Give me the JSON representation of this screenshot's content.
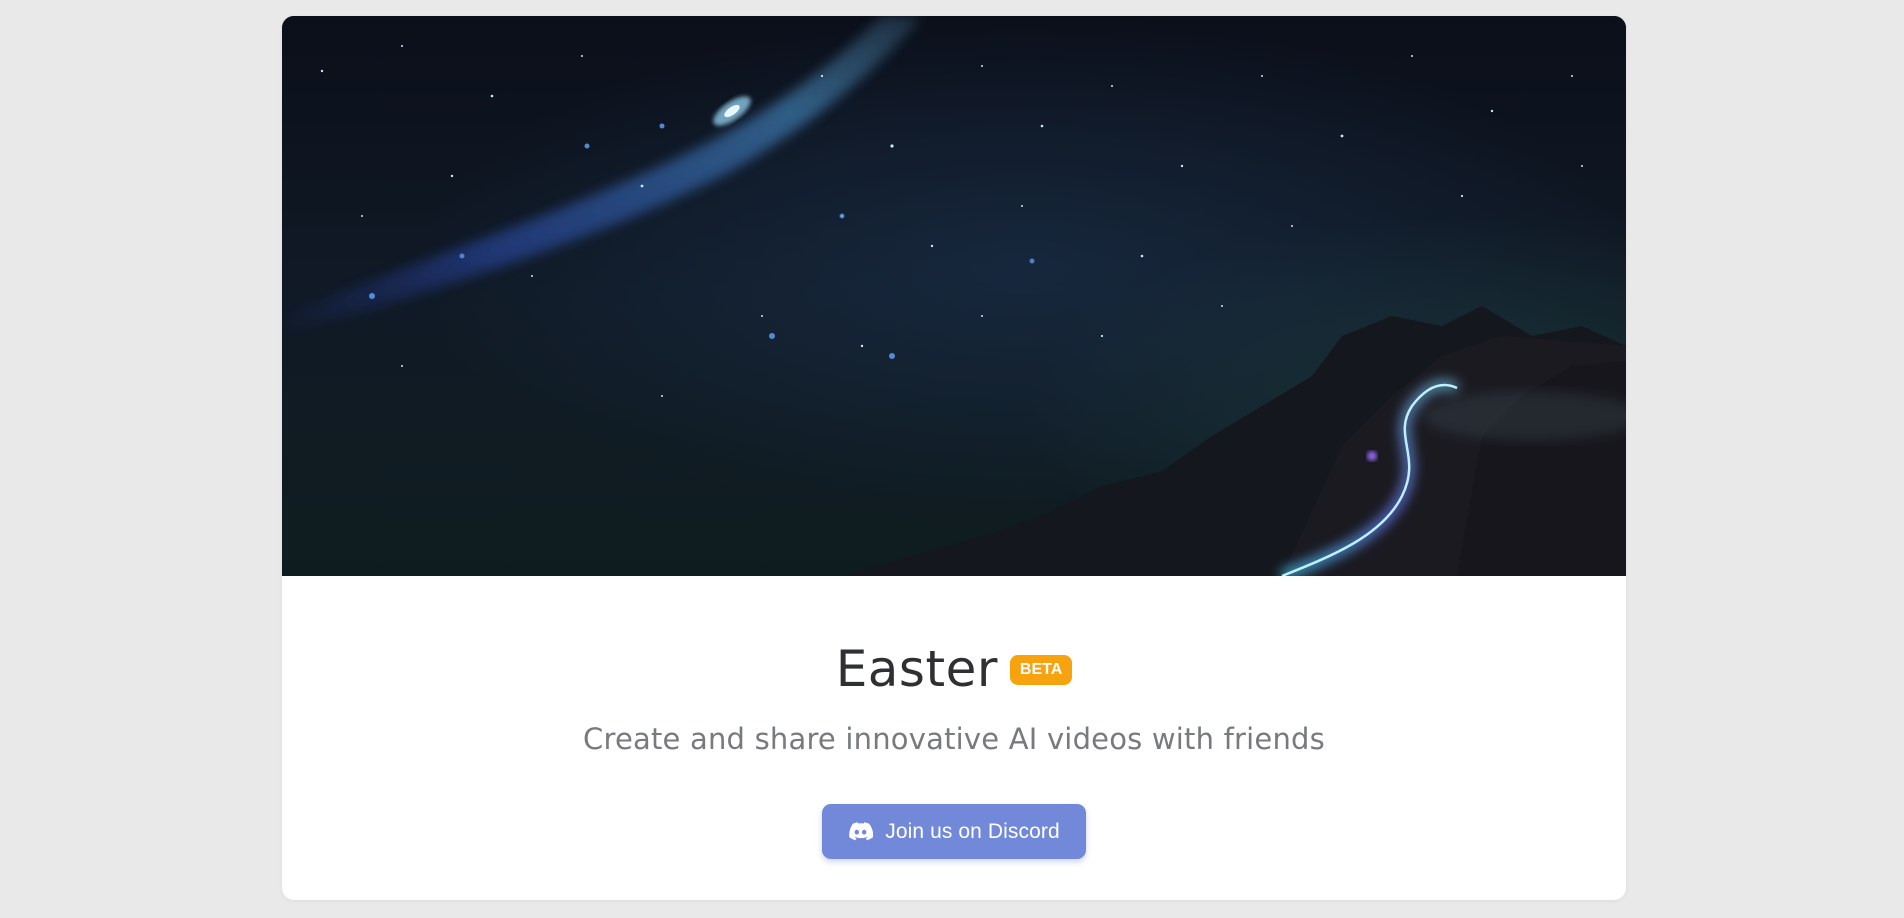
{
  "hero": {
    "image": "night-sky-galaxy-mountain"
  },
  "app": {
    "title": "Easter",
    "badge": "BETA",
    "subtitle": "Create and share innovative AI videos with friends"
  },
  "cta": {
    "label": "Join us on Discord",
    "icon": "discord-icon"
  },
  "colors": {
    "page_background": "#e9e9e9",
    "card_background": "#ffffff",
    "badge": "#f7a310",
    "discord_button": "#7289da",
    "title_text": "#2f3033",
    "subtitle_text": "#777a7f"
  }
}
